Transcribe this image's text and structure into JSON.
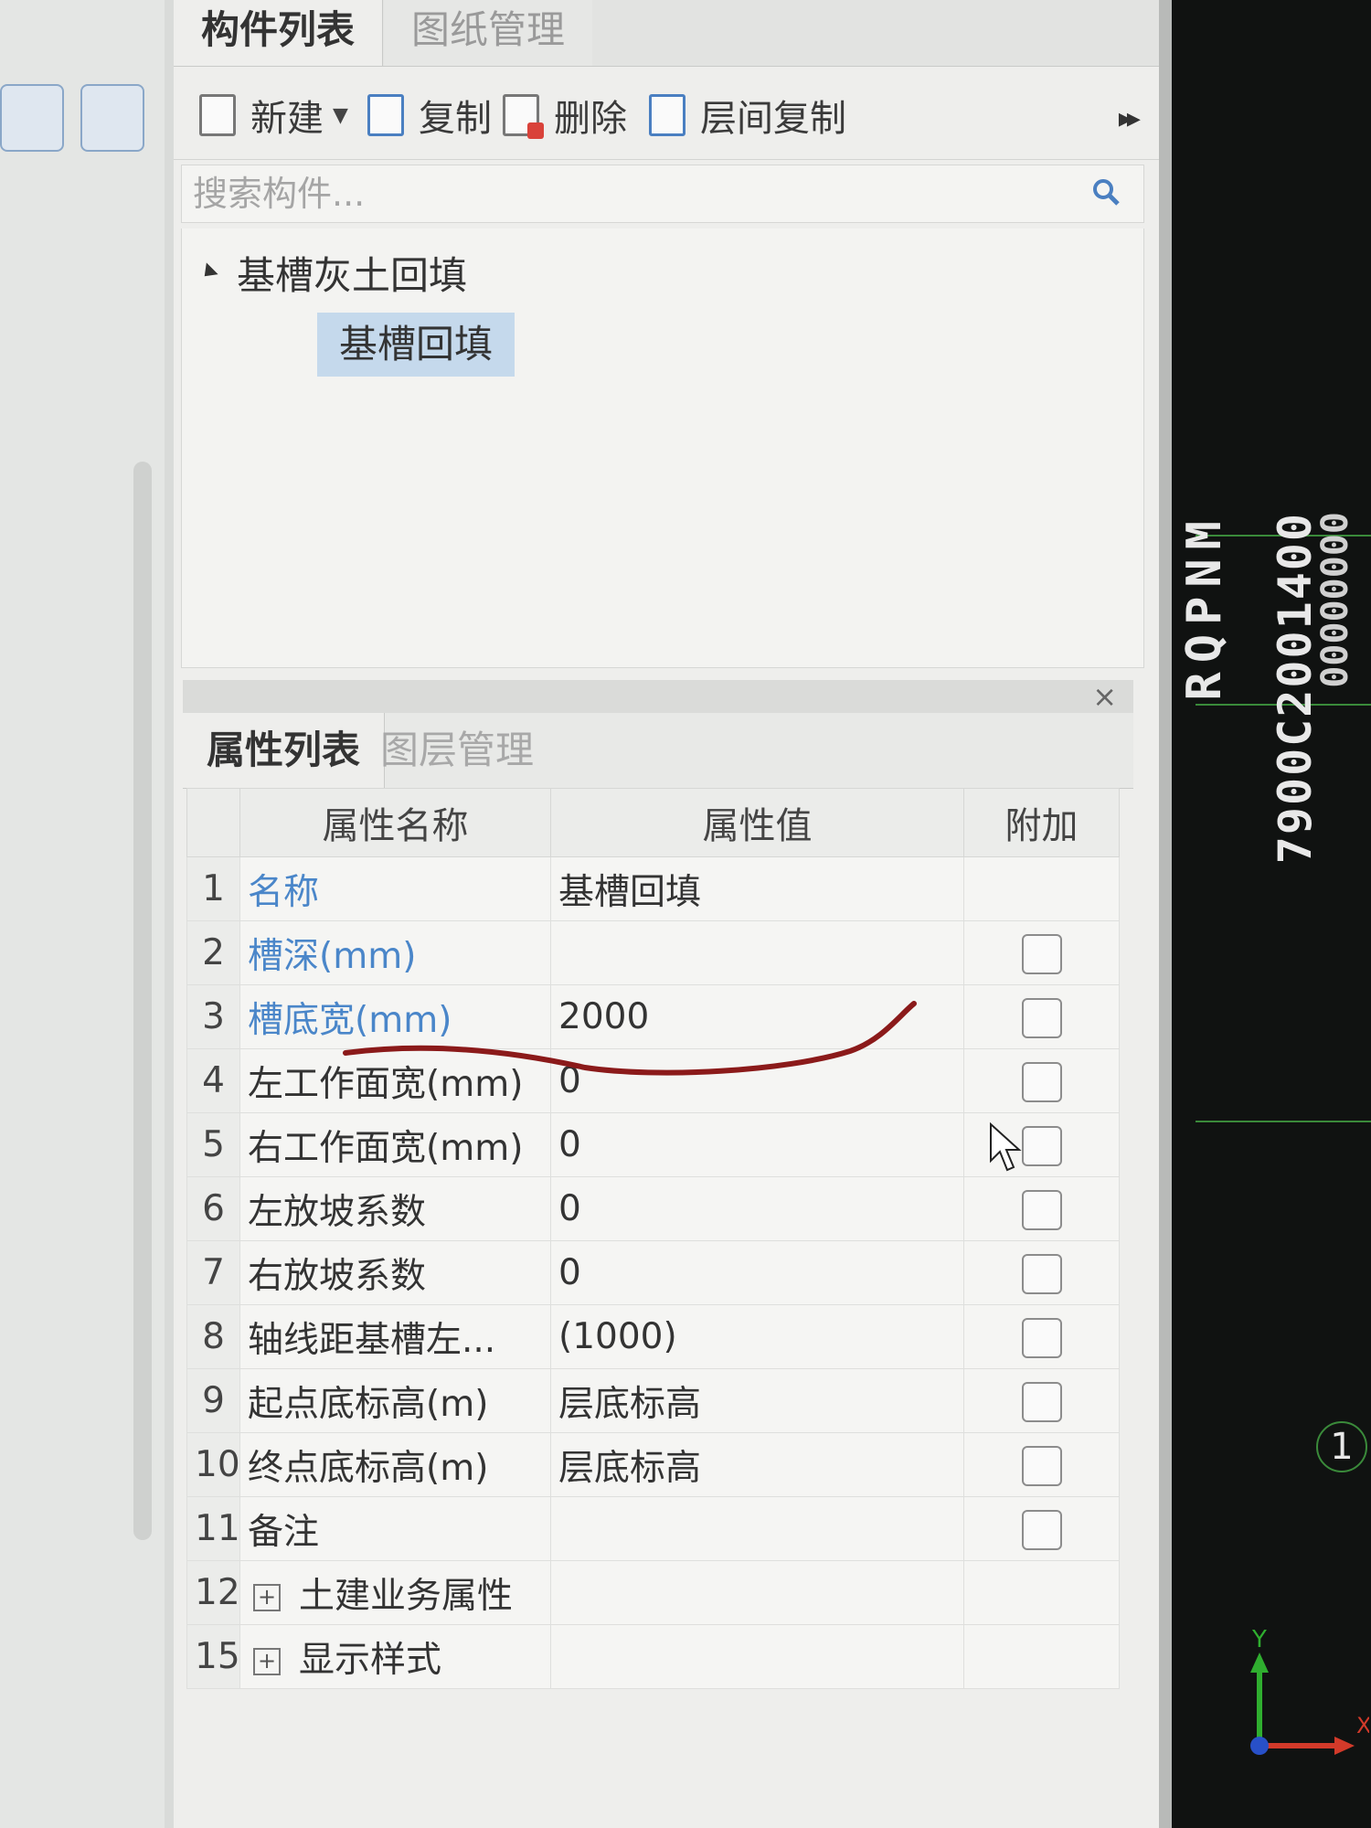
{
  "top_tabs": [
    "构件列表",
    "图纸管理"
  ],
  "toolbar": {
    "new_label": "新建",
    "copy_label": "复制",
    "delete_label": "删除",
    "floor_copy_label": "层间复制",
    "more_glyph": "▸▸"
  },
  "search": {
    "placeholder": "搜索构件..."
  },
  "tree": {
    "parent_label": "基槽灰土回填",
    "child_label": "基槽回填"
  },
  "property_tabs": [
    "属性列表",
    "图层管理"
  ],
  "property_table": {
    "headers": [
      "属性名称",
      "属性值",
      "附加"
    ],
    "rows": [
      {
        "num": "1",
        "name": "名称",
        "value": "基槽回填",
        "name_color": "blue",
        "checkbox": false
      },
      {
        "num": "2",
        "name": "槽深(mm)",
        "value": "",
        "name_color": "blue",
        "checkbox": true
      },
      {
        "num": "3",
        "name": "槽底宽(mm)",
        "value": "2000",
        "name_color": "blue",
        "checkbox": true
      },
      {
        "num": "4",
        "name": "左工作面宽(mm)",
        "value": "0",
        "name_color": "dark",
        "checkbox": true
      },
      {
        "num": "5",
        "name": "右工作面宽(mm)",
        "value": "0",
        "name_color": "dark",
        "checkbox": true
      },
      {
        "num": "6",
        "name": "左放坡系数",
        "value": "0",
        "name_color": "dark",
        "checkbox": true
      },
      {
        "num": "7",
        "name": "右放坡系数",
        "value": "0",
        "name_color": "dark",
        "checkbox": true
      },
      {
        "num": "8",
        "name": "轴线距基槽左...",
        "value": "(1000)",
        "name_color": "dark",
        "checkbox": true
      },
      {
        "num": "9",
        "name": "起点底标高(m)",
        "value": "层底标高",
        "name_color": "dark",
        "checkbox": true
      },
      {
        "num": "10",
        "name": "终点底标高(m)",
        "value": "层底标高",
        "name_color": "dark",
        "checkbox": true
      },
      {
        "num": "11",
        "name": "备注",
        "value": "",
        "name_color": "dark",
        "checkbox": true
      },
      {
        "num": "12",
        "name": "土建业务属性",
        "value": "",
        "name_color": "dark",
        "checkbox": false,
        "expandable": true
      },
      {
        "num": "15",
        "name": "显示样式",
        "value": "",
        "name_color": "dark",
        "checkbox": false,
        "expandable": true
      }
    ]
  },
  "cad": {
    "axis_letters_top": "RQPNM",
    "dim_text_a": "7900C2001400",
    "dim_text_b": "00000000",
    "axis_bubble": "1",
    "axis_y": "Y",
    "axis_x": "X"
  },
  "colors": {
    "link_blue": "#4a86c9",
    "selection": "#c5d9ec",
    "annotation_red": "#8b1a1a",
    "cad_bg": "#101211",
    "cad_green": "#3a8a3a"
  }
}
